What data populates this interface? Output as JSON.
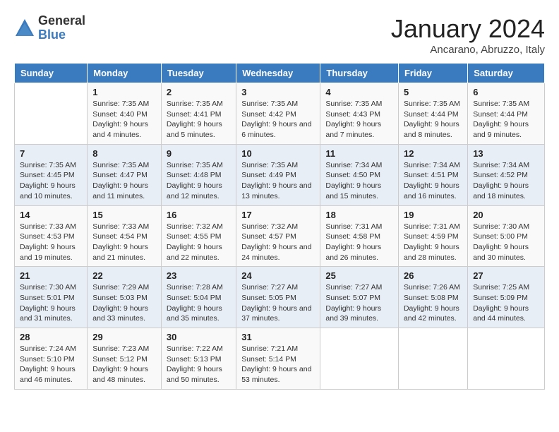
{
  "logo": {
    "general": "General",
    "blue": "Blue"
  },
  "header": {
    "title": "January 2024",
    "location": "Ancarano, Abruzzo, Italy"
  },
  "weekdays": [
    "Sunday",
    "Monday",
    "Tuesday",
    "Wednesday",
    "Thursday",
    "Friday",
    "Saturday"
  ],
  "weeks": [
    [
      {
        "day": "",
        "sunrise": "",
        "sunset": "",
        "daylight": ""
      },
      {
        "day": "1",
        "sunrise": "Sunrise: 7:35 AM",
        "sunset": "Sunset: 4:40 PM",
        "daylight": "Daylight: 9 hours and 4 minutes."
      },
      {
        "day": "2",
        "sunrise": "Sunrise: 7:35 AM",
        "sunset": "Sunset: 4:41 PM",
        "daylight": "Daylight: 9 hours and 5 minutes."
      },
      {
        "day": "3",
        "sunrise": "Sunrise: 7:35 AM",
        "sunset": "Sunset: 4:42 PM",
        "daylight": "Daylight: 9 hours and 6 minutes."
      },
      {
        "day": "4",
        "sunrise": "Sunrise: 7:35 AM",
        "sunset": "Sunset: 4:43 PM",
        "daylight": "Daylight: 9 hours and 7 minutes."
      },
      {
        "day": "5",
        "sunrise": "Sunrise: 7:35 AM",
        "sunset": "Sunset: 4:44 PM",
        "daylight": "Daylight: 9 hours and 8 minutes."
      },
      {
        "day": "6",
        "sunrise": "Sunrise: 7:35 AM",
        "sunset": "Sunset: 4:44 PM",
        "daylight": "Daylight: 9 hours and 9 minutes."
      }
    ],
    [
      {
        "day": "7",
        "sunrise": "Sunrise: 7:35 AM",
        "sunset": "Sunset: 4:45 PM",
        "daylight": "Daylight: 9 hours and 10 minutes."
      },
      {
        "day": "8",
        "sunrise": "Sunrise: 7:35 AM",
        "sunset": "Sunset: 4:47 PM",
        "daylight": "Daylight: 9 hours and 11 minutes."
      },
      {
        "day": "9",
        "sunrise": "Sunrise: 7:35 AM",
        "sunset": "Sunset: 4:48 PM",
        "daylight": "Daylight: 9 hours and 12 minutes."
      },
      {
        "day": "10",
        "sunrise": "Sunrise: 7:35 AM",
        "sunset": "Sunset: 4:49 PM",
        "daylight": "Daylight: 9 hours and 13 minutes."
      },
      {
        "day": "11",
        "sunrise": "Sunrise: 7:34 AM",
        "sunset": "Sunset: 4:50 PM",
        "daylight": "Daylight: 9 hours and 15 minutes."
      },
      {
        "day": "12",
        "sunrise": "Sunrise: 7:34 AM",
        "sunset": "Sunset: 4:51 PM",
        "daylight": "Daylight: 9 hours and 16 minutes."
      },
      {
        "day": "13",
        "sunrise": "Sunrise: 7:34 AM",
        "sunset": "Sunset: 4:52 PM",
        "daylight": "Daylight: 9 hours and 18 minutes."
      }
    ],
    [
      {
        "day": "14",
        "sunrise": "Sunrise: 7:33 AM",
        "sunset": "Sunset: 4:53 PM",
        "daylight": "Daylight: 9 hours and 19 minutes."
      },
      {
        "day": "15",
        "sunrise": "Sunrise: 7:33 AM",
        "sunset": "Sunset: 4:54 PM",
        "daylight": "Daylight: 9 hours and 21 minutes."
      },
      {
        "day": "16",
        "sunrise": "Sunrise: 7:32 AM",
        "sunset": "Sunset: 4:55 PM",
        "daylight": "Daylight: 9 hours and 22 minutes."
      },
      {
        "day": "17",
        "sunrise": "Sunrise: 7:32 AM",
        "sunset": "Sunset: 4:57 PM",
        "daylight": "Daylight: 9 hours and 24 minutes."
      },
      {
        "day": "18",
        "sunrise": "Sunrise: 7:31 AM",
        "sunset": "Sunset: 4:58 PM",
        "daylight": "Daylight: 9 hours and 26 minutes."
      },
      {
        "day": "19",
        "sunrise": "Sunrise: 7:31 AM",
        "sunset": "Sunset: 4:59 PM",
        "daylight": "Daylight: 9 hours and 28 minutes."
      },
      {
        "day": "20",
        "sunrise": "Sunrise: 7:30 AM",
        "sunset": "Sunset: 5:00 PM",
        "daylight": "Daylight: 9 hours and 30 minutes."
      }
    ],
    [
      {
        "day": "21",
        "sunrise": "Sunrise: 7:30 AM",
        "sunset": "Sunset: 5:01 PM",
        "daylight": "Daylight: 9 hours and 31 minutes."
      },
      {
        "day": "22",
        "sunrise": "Sunrise: 7:29 AM",
        "sunset": "Sunset: 5:03 PM",
        "daylight": "Daylight: 9 hours and 33 minutes."
      },
      {
        "day": "23",
        "sunrise": "Sunrise: 7:28 AM",
        "sunset": "Sunset: 5:04 PM",
        "daylight": "Daylight: 9 hours and 35 minutes."
      },
      {
        "day": "24",
        "sunrise": "Sunrise: 7:27 AM",
        "sunset": "Sunset: 5:05 PM",
        "daylight": "Daylight: 9 hours and 37 minutes."
      },
      {
        "day": "25",
        "sunrise": "Sunrise: 7:27 AM",
        "sunset": "Sunset: 5:07 PM",
        "daylight": "Daylight: 9 hours and 39 minutes."
      },
      {
        "day": "26",
        "sunrise": "Sunrise: 7:26 AM",
        "sunset": "Sunset: 5:08 PM",
        "daylight": "Daylight: 9 hours and 42 minutes."
      },
      {
        "day": "27",
        "sunrise": "Sunrise: 7:25 AM",
        "sunset": "Sunset: 5:09 PM",
        "daylight": "Daylight: 9 hours and 44 minutes."
      }
    ],
    [
      {
        "day": "28",
        "sunrise": "Sunrise: 7:24 AM",
        "sunset": "Sunset: 5:10 PM",
        "daylight": "Daylight: 9 hours and 46 minutes."
      },
      {
        "day": "29",
        "sunrise": "Sunrise: 7:23 AM",
        "sunset": "Sunset: 5:12 PM",
        "daylight": "Daylight: 9 hours and 48 minutes."
      },
      {
        "day": "30",
        "sunrise": "Sunrise: 7:22 AM",
        "sunset": "Sunset: 5:13 PM",
        "daylight": "Daylight: 9 hours and 50 minutes."
      },
      {
        "day": "31",
        "sunrise": "Sunrise: 7:21 AM",
        "sunset": "Sunset: 5:14 PM",
        "daylight": "Daylight: 9 hours and 53 minutes."
      },
      {
        "day": "",
        "sunrise": "",
        "sunset": "",
        "daylight": ""
      },
      {
        "day": "",
        "sunrise": "",
        "sunset": "",
        "daylight": ""
      },
      {
        "day": "",
        "sunrise": "",
        "sunset": "",
        "daylight": ""
      }
    ]
  ]
}
